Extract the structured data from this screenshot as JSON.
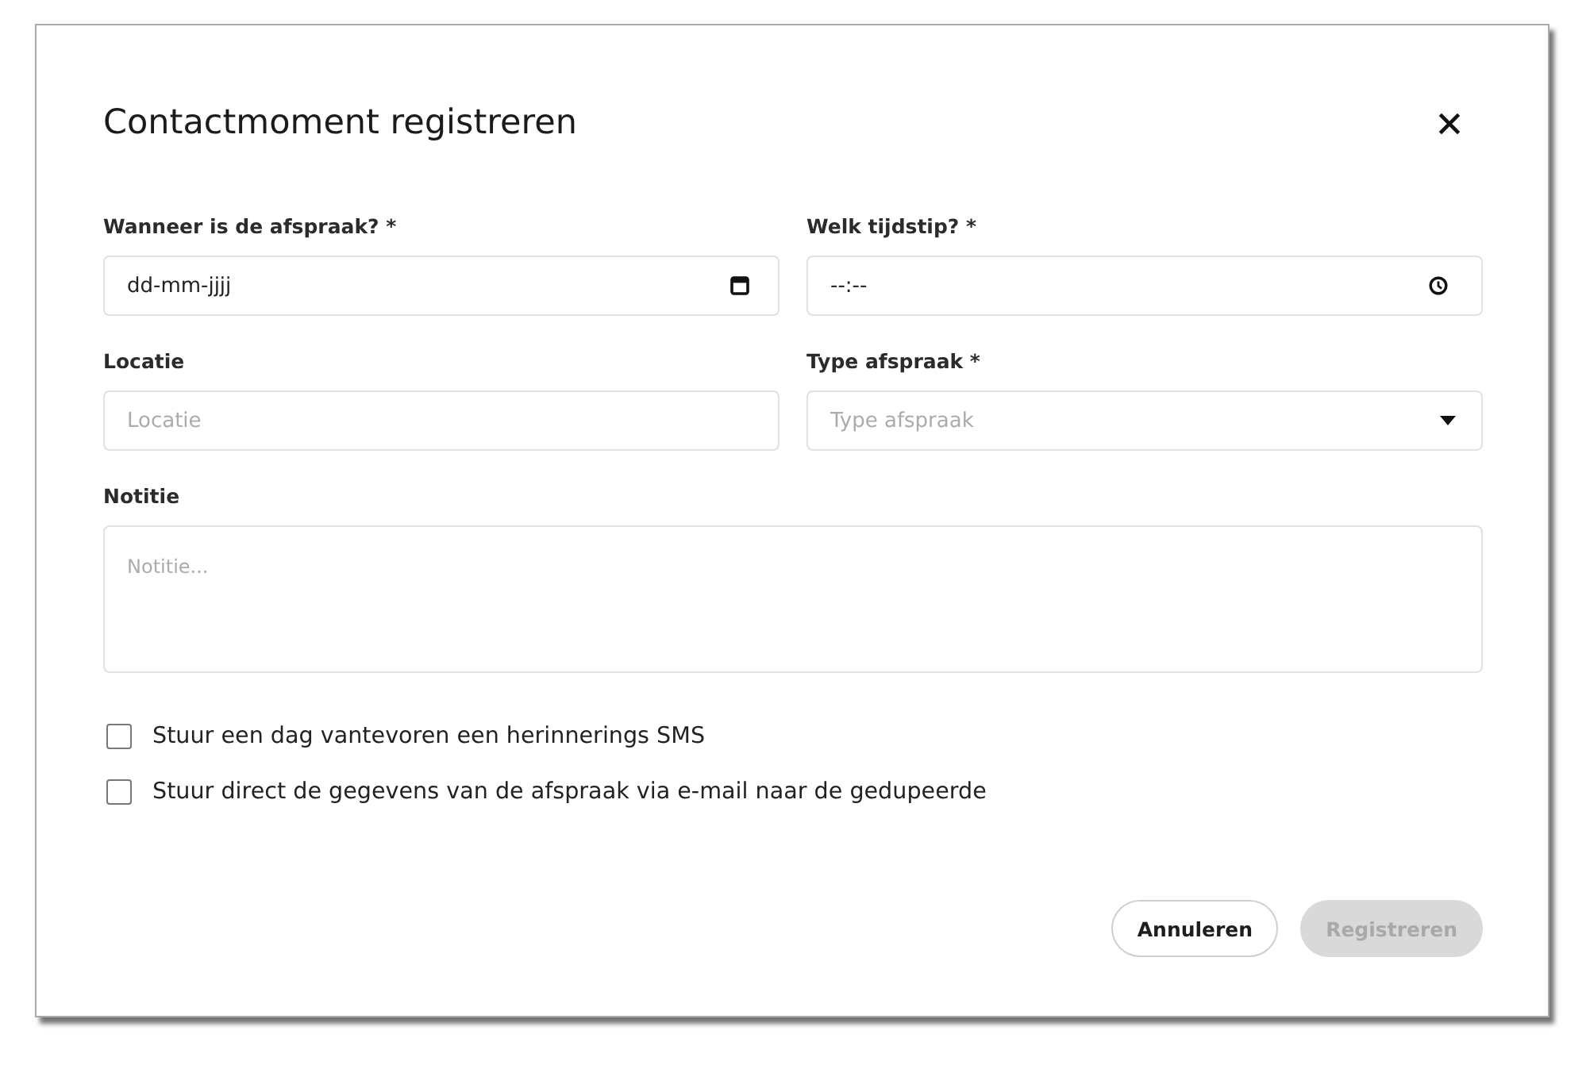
{
  "dialog": {
    "title": "Contactmoment registreren"
  },
  "fields": [
    {
      "kind": "date",
      "label": "Wanneer is de afspraak? *",
      "value": "dd-mm-jjjj"
    },
    {
      "kind": "time",
      "label": "Welk tijdstip? *",
      "value": "--:--"
    },
    {
      "kind": "text",
      "label": "Locatie",
      "placeholder": "Locatie"
    },
    {
      "kind": "select",
      "label": "Type afspraak *",
      "placeholder": "Type afspraak"
    },
    {
      "kind": "textarea",
      "label": "Notitie",
      "placeholder": "Notitie..."
    }
  ],
  "checkboxes": [
    {
      "label": "Stuur een dag vantevoren een herinnerings SMS",
      "checked": false
    },
    {
      "label": "Stuur direct de gegevens van de afspraak via e-mail naar de gedupeerde",
      "checked": false
    }
  ],
  "buttons": [
    {
      "label": "Annuleren",
      "kind": "outline",
      "disabled": false
    },
    {
      "label": "Registreren",
      "kind": "filled",
      "disabled": true
    }
  ]
}
